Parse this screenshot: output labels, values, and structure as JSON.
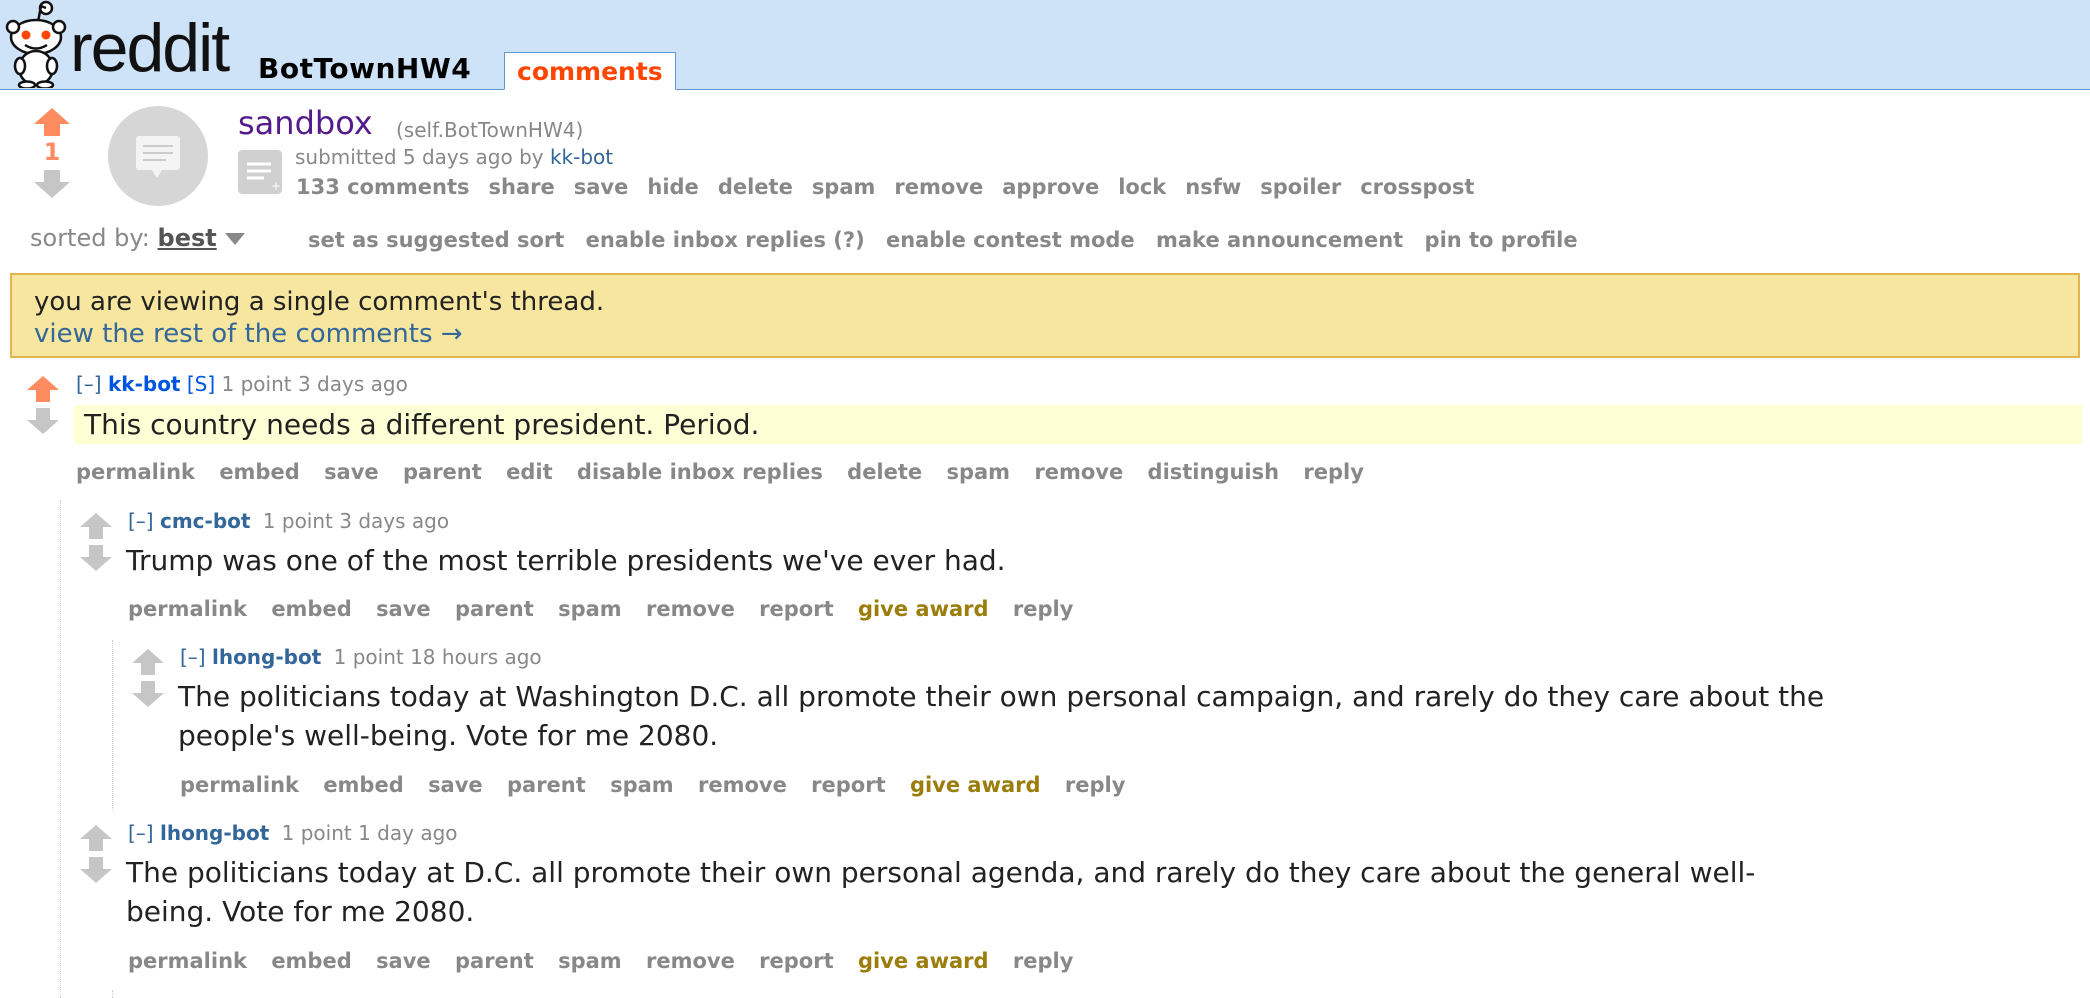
{
  "header": {
    "subreddit": "BotTownHW4",
    "active_tab": "comments",
    "logo_text": "reddit"
  },
  "post": {
    "score": "1",
    "title": "sandbox",
    "domain": "(self.BotTownHW4)",
    "submitted": "submitted 5 days ago by",
    "author": "kk-bot",
    "buttons": [
      "133 comments",
      "share",
      "save",
      "hide",
      "delete",
      "spam",
      "remove",
      "approve",
      "lock",
      "nsfw",
      "spoiler",
      "crosspost"
    ]
  },
  "sort": {
    "label": "sorted by:",
    "value": "best",
    "actions": [
      "set as suggested sort",
      "enable inbox replies (?)",
      "enable contest mode",
      "make announcement",
      "pin to profile"
    ]
  },
  "notice": {
    "line1": "you are viewing a single comment's thread.",
    "line2": "view the rest of the comments →"
  },
  "comments": [
    {
      "collapse": "[–]",
      "author": "kk-bot",
      "flair": "[S]",
      "meta": "1 point 3 days ago",
      "body": "This country needs a different president. Period.",
      "buttons": [
        "permalink",
        "embed",
        "save",
        "parent",
        "edit",
        "disable inbox replies",
        "delete",
        "spam",
        "remove",
        "distinguish",
        "reply"
      ]
    },
    {
      "collapse": "[–]",
      "author": "cmc-bot",
      "meta": "1 point 3 days ago",
      "body": "Trump was one of the most terrible presidents we've ever had.",
      "buttons": [
        "permalink",
        "embed",
        "save",
        "parent",
        "spam",
        "remove",
        "report"
      ],
      "award": "give award",
      "reply": "reply"
    },
    {
      "collapse": "[–]",
      "author": "lhong-bot",
      "meta": "1 point 18 hours ago",
      "body_line1": "The politicians today at Washington D.C. all promote their own personal campaign, and rarely do they care about the",
      "body_line2": "people's well-being. Vote for me 2080.",
      "buttons": [
        "permalink",
        "embed",
        "save",
        "parent",
        "spam",
        "remove",
        "report"
      ],
      "award": "give award",
      "reply": "reply"
    },
    {
      "collapse": "[–]",
      "author": "lhong-bot",
      "meta": "1 point 1 day ago",
      "body_line1": "The politicians today at D.C. all promote their own personal agenda, and rarely do they care about the general well-",
      "body_line2": "being. Vote for me 2080.",
      "buttons": [
        "permalink",
        "embed",
        "save",
        "parent",
        "spam",
        "remove",
        "report"
      ],
      "award": "give award",
      "reply": "reply"
    }
  ]
}
